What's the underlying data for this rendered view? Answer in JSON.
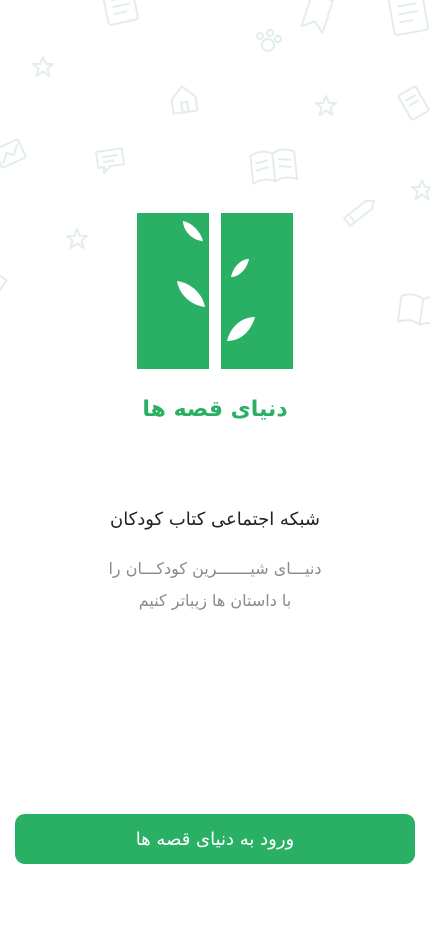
{
  "app": {
    "name": "دنیای قصه ها",
    "brand_color": "#2ab065",
    "logo_icon": "book-with-leaves-icon"
  },
  "intro": {
    "headline": "شبکه اجتماعی کتاب کودکان",
    "tagline_line1": "دنیـــای شیـــــــرین کودکـــان را",
    "tagline_line2": "با داستان ها زیباتر کنیم"
  },
  "background_icons": [
    "book-icon",
    "bookmark-icon",
    "star-icon",
    "paw-icon",
    "house-icon",
    "pencil-icon",
    "chat-icon",
    "open-book-icon",
    "note-icon"
  ],
  "actions": {
    "enter_label": "ورود به دنیای قصه ها"
  }
}
